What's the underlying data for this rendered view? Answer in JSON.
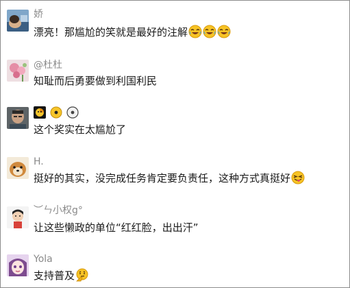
{
  "comments": [
    {
      "username": "娇",
      "text": "漂亮！那尴尬的笑就是最好的注解",
      "emojis": [
        "laugh-cry-emoji",
        "laugh-cry-emoji",
        "laugh-cry-emoji"
      ]
    },
    {
      "username": "@杜杜",
      "text": "知耻而后勇要做到利国利民"
    },
    {
      "username": "",
      "name_icons": [
        "yellow-face-emoji",
        "yellow-dot-emoji",
        "gray-dot-emoji"
      ],
      "text": "这个奖实在太尴尬了"
    },
    {
      "username": "H.",
      "text": "挺好的其实，没完成任务肯定要负责任，这种方式真挺好",
      "emojis": [
        "tongue-wink-emoji"
      ]
    },
    {
      "username": "︶ㄣ小权g°",
      "text": "让这些懒政的单位“红红脸，出出汗”"
    },
    {
      "username": "Yola",
      "text": "支持普及",
      "emojis": [
        "thinking-face-emoji"
      ]
    }
  ]
}
